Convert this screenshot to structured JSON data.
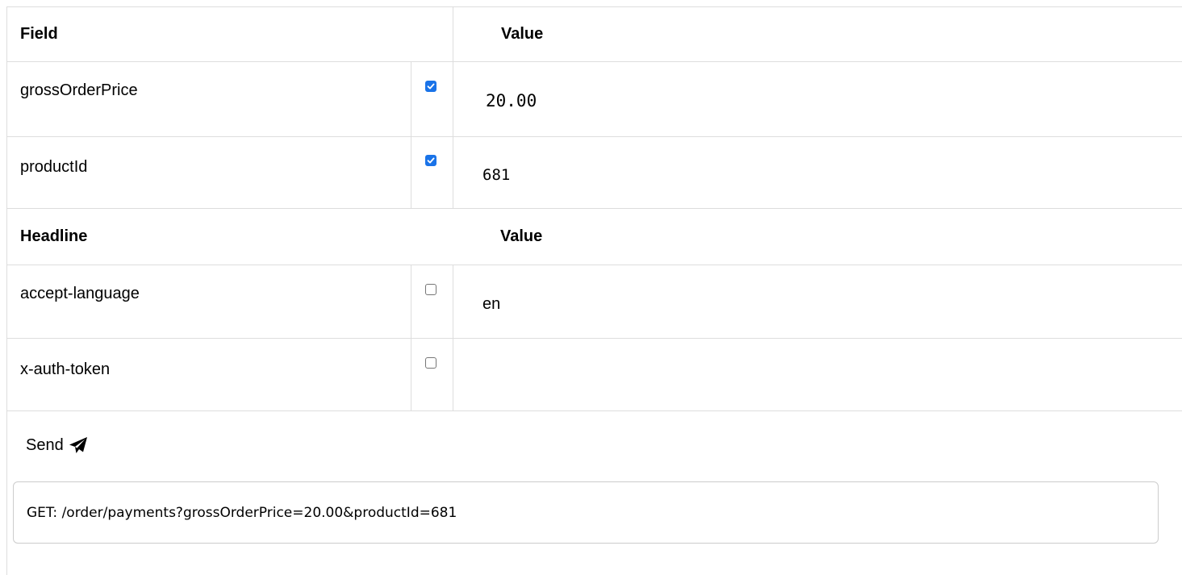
{
  "fields_table": {
    "header": {
      "name": "Field",
      "value": "Value"
    },
    "rows": [
      {
        "name": "grossOrderPrice",
        "checked": true,
        "value": "20.00",
        "mono": true
      },
      {
        "name": "productId",
        "checked": true,
        "value": "681",
        "mono": true
      }
    ]
  },
  "headers_table": {
    "header": {
      "name": "Headline",
      "value": "Value"
    },
    "rows": [
      {
        "name": "accept-language",
        "checked": false,
        "value": "en"
      },
      {
        "name": "x-auth-token",
        "checked": false,
        "value": ""
      }
    ]
  },
  "send": {
    "label": "Send",
    "icon": "paper-plane-icon"
  },
  "request_preview": {
    "text": "GET: /order/payments?grossOrderPrice=20.00&productId=681"
  },
  "colors": {
    "checkbox_on": "#1a73e8",
    "border": "#dddddd"
  }
}
